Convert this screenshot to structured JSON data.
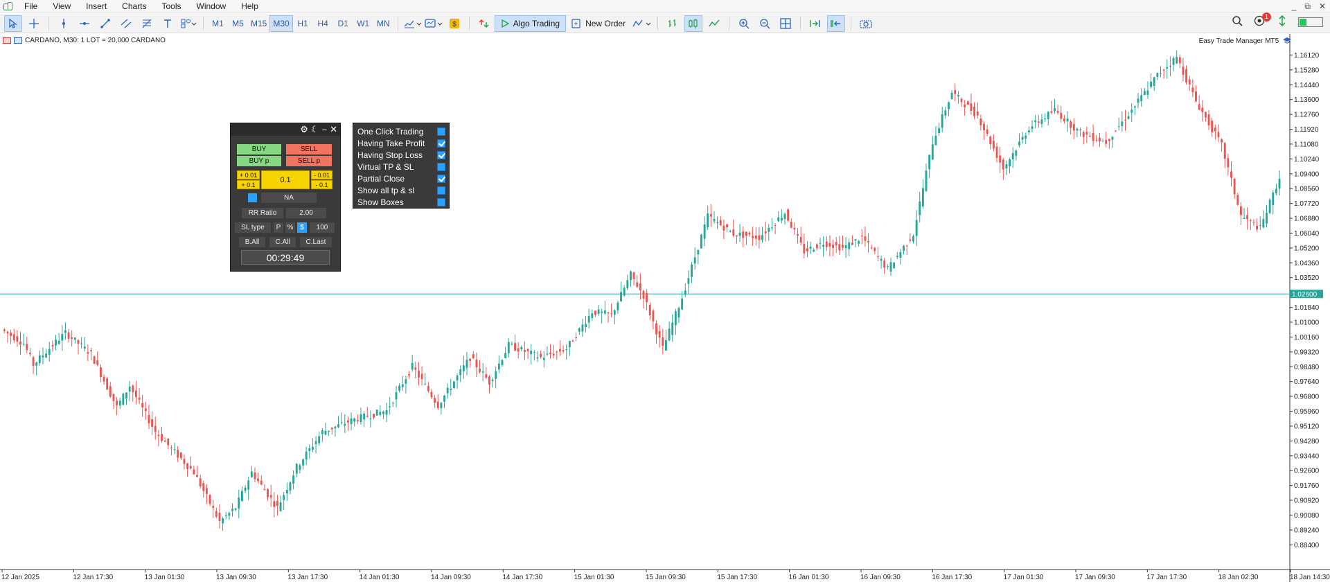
{
  "menu": {
    "items": [
      "File",
      "View",
      "Insert",
      "Charts",
      "Tools",
      "Window",
      "Help"
    ]
  },
  "window_controls": [
    "_",
    "⧉",
    "✕"
  ],
  "toolbar": {
    "timeframes": [
      "M1",
      "M5",
      "M15",
      "M30",
      "H1",
      "H4",
      "D1",
      "W1",
      "MN"
    ],
    "active_timeframe": "M30",
    "algo_trading_label": "Algo Trading",
    "new_order_label": "New Order",
    "notification_count": "1",
    "signal_level": 0.3
  },
  "chart": {
    "header_text": "CARDANO, M30:  1 LOT = 20,000 CARDANO",
    "ea_label": "Easy Trade Manager MT5",
    "current_price_label": "1.02600"
  },
  "trade_panel": {
    "buy_label": "BUY",
    "sell_label": "SELL",
    "buy_p_label": "BUY p",
    "sell_p_label": "SELL p",
    "plus_001": "+ 0.01",
    "plus_01": "+ 0.1",
    "lot_value": "0.1",
    "minus_001": "- 0.01",
    "minus_01": "- 0.1",
    "na_label": "NA",
    "rr_label": "RR Ratio",
    "rr_value": "2.00",
    "sl_type_label": "SL type",
    "p_label": "P",
    "percent_label": "%",
    "dollar_label": "$",
    "sl_value": "100",
    "b_all_label": "B.All",
    "c_all_label": "C.All",
    "c_last_label": "C.Last",
    "timer": "00:29:49"
  },
  "options_panel": {
    "items": [
      {
        "label": "One Click Trading",
        "checked": false
      },
      {
        "label": "Having Take Profit",
        "checked": true
      },
      {
        "label": "Having Stop Loss",
        "checked": true
      },
      {
        "label": "Virtual TP & SL",
        "checked": false
      },
      {
        "label": "Partial Close",
        "checked": true
      },
      {
        "label": "Show all tp & sl",
        "checked": false
      },
      {
        "label": "Show Boxes",
        "checked": false
      }
    ]
  },
  "chart_data": {
    "type": "candlestick",
    "symbol": "CARDANO",
    "timeframe": "M30",
    "ylim": [
      0.87,
      1.17
    ],
    "current_price": 1.026,
    "y_ticks": [
      "1.16120",
      "1.15280",
      "1.14440",
      "1.13600",
      "1.12760",
      "1.11920",
      "1.11080",
      "1.10240",
      "1.09400",
      "1.08560",
      "1.07720",
      "1.06880",
      "1.06040",
      "1.05200",
      "1.04360",
      "1.03520",
      "1.01840",
      "1.01000",
      "1.00160",
      "0.99320",
      "0.98480",
      "0.97640",
      "0.96800",
      "0.95960",
      "0.95120",
      "0.94280",
      "0.93440",
      "0.92600",
      "0.91760",
      "0.90920",
      "0.90080",
      "0.89240",
      "0.88400"
    ],
    "x_ticks": [
      "12 Jan 2025",
      "12 Jan 17:30",
      "13 Jan 01:30",
      "13 Jan 09:30",
      "13 Jan 17:30",
      "14 Jan 01:30",
      "14 Jan 09:30",
      "14 Jan 17:30",
      "15 Jan 01:30",
      "15 Jan 09:30",
      "15 Jan 17:30",
      "16 Jan 01:30",
      "16 Jan 09:30",
      "16 Jan 17:30",
      "17 Jan 01:30",
      "17 Jan 09:30",
      "17 Jan 17:30",
      "18 Jan 02:30",
      "18 Jan 14:30"
    ],
    "anchors": [
      [
        0,
        1.006
      ],
      [
        7,
        0.998
      ],
      [
        10,
        0.986
      ],
      [
        16,
        0.997
      ],
      [
        20,
        1.004
      ],
      [
        28,
        0.992
      ],
      [
        36,
        0.962
      ],
      [
        40,
        0.974
      ],
      [
        48,
        0.948
      ],
      [
        60,
        0.925
      ],
      [
        68,
        0.897
      ],
      [
        73,
        0.905
      ],
      [
        78,
        0.925
      ],
      [
        86,
        0.905
      ],
      [
        92,
        0.928
      ],
      [
        100,
        0.948
      ],
      [
        110,
        0.955
      ],
      [
        120,
        0.96
      ],
      [
        128,
        0.985
      ],
      [
        136,
        0.963
      ],
      [
        146,
        0.99
      ],
      [
        152,
        0.976
      ],
      [
        158,
        0.997
      ],
      [
        168,
        0.99
      ],
      [
        176,
        0.995
      ],
      [
        184,
        1.016
      ],
      [
        190,
        1.014
      ],
      [
        196,
        1.037
      ],
      [
        200,
        1.025
      ],
      [
        206,
        0.995
      ],
      [
        212,
        1.024
      ],
      [
        220,
        1.07
      ],
      [
        228,
        1.06
      ],
      [
        236,
        1.058
      ],
      [
        244,
        1.072
      ],
      [
        250,
        1.05
      ],
      [
        256,
        1.055
      ],
      [
        262,
        1.052
      ],
      [
        268,
        1.058
      ],
      [
        276,
        1.04
      ],
      [
        284,
        1.06
      ],
      [
        290,
        1.112
      ],
      [
        296,
        1.14
      ],
      [
        304,
        1.127
      ],
      [
        312,
        1.097
      ],
      [
        320,
        1.12
      ],
      [
        328,
        1.13
      ],
      [
        336,
        1.117
      ],
      [
        344,
        1.112
      ],
      [
        352,
        1.13
      ],
      [
        360,
        1.15
      ],
      [
        366,
        1.16
      ],
      [
        372,
        1.135
      ],
      [
        380,
        1.11
      ],
      [
        386,
        1.07
      ],
      [
        392,
        1.063
      ],
      [
        398,
        1.092
      ]
    ]
  }
}
